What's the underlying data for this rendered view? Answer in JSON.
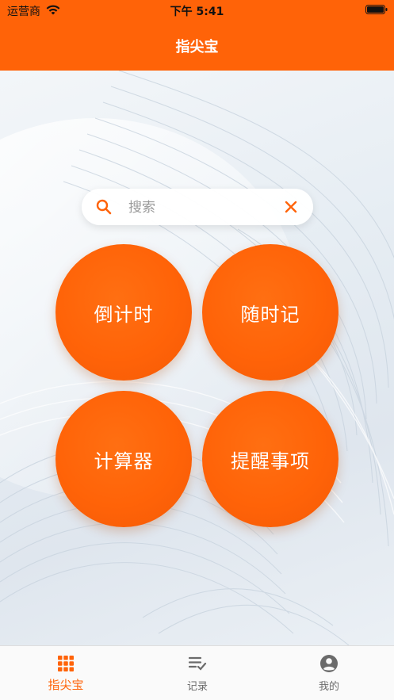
{
  "status_bar": {
    "carrier": "运营商",
    "time": "下午 5:41"
  },
  "header": {
    "title": "指尖宝"
  },
  "search": {
    "placeholder": "搜索",
    "value": ""
  },
  "tiles": [
    {
      "label": "倒计时"
    },
    {
      "label": "随时记"
    },
    {
      "label": "计算器"
    },
    {
      "label": "提醒事项"
    }
  ],
  "tabbar": {
    "items": [
      {
        "label": "指尖宝",
        "icon": "grid-icon",
        "active": true
      },
      {
        "label": "记录",
        "icon": "checklist-icon",
        "active": false
      },
      {
        "label": "我的",
        "icon": "profile-icon",
        "active": false
      }
    ]
  },
  "colors": {
    "accent": "#FF6308",
    "tab_inactive": "#6b6b6b",
    "background": "#e6edf3"
  }
}
